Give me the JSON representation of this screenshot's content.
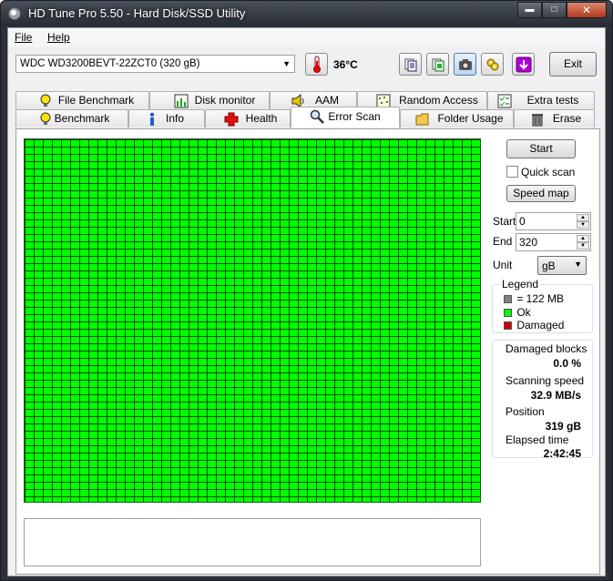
{
  "window": {
    "title": "HD Tune Pro 5.50 - Hard Disk/SSD Utility"
  },
  "menu": {
    "file": "File",
    "help": "Help"
  },
  "toolbar": {
    "drive": "WDC WD3200BEVT-22ZCT0 (320 gB)",
    "temperature": "36°C",
    "exit_label": "Exit"
  },
  "tabs": {
    "row_back": [
      "File Benchmark",
      "Disk monitor",
      "AAM",
      "Random Access",
      "Extra tests"
    ],
    "row_front": [
      "Benchmark",
      "Info",
      "Health",
      "Error Scan",
      "Folder Usage",
      "Erase"
    ],
    "active": "Error Scan"
  },
  "scan": {
    "start_button": "Start",
    "quick_scan_label": "Quick scan",
    "quick_scan_checked": false,
    "speed_map_button": "Speed map",
    "start_label": "Start",
    "start_value": "0",
    "end_label": "End",
    "end_value": "320",
    "unit_label": "Unit",
    "unit_value": "gB"
  },
  "legend": {
    "title": "Legend",
    "block_size": "= 122 MB",
    "ok": "Ok",
    "damaged": "Damaged",
    "colors": {
      "block": "#808080",
      "ok": "#00ff00",
      "damaged": "#cc0000"
    }
  },
  "stats": {
    "damaged_blocks_label": "Damaged blocks",
    "damaged_blocks_value": "0.0 %",
    "scanning_speed_label": "Scanning speed",
    "scanning_speed_value": "32.9 MB/s",
    "position_label": "Position",
    "position_value": "319 gB",
    "elapsed_label": "Elapsed time",
    "elapsed_value": "2:42:45"
  }
}
